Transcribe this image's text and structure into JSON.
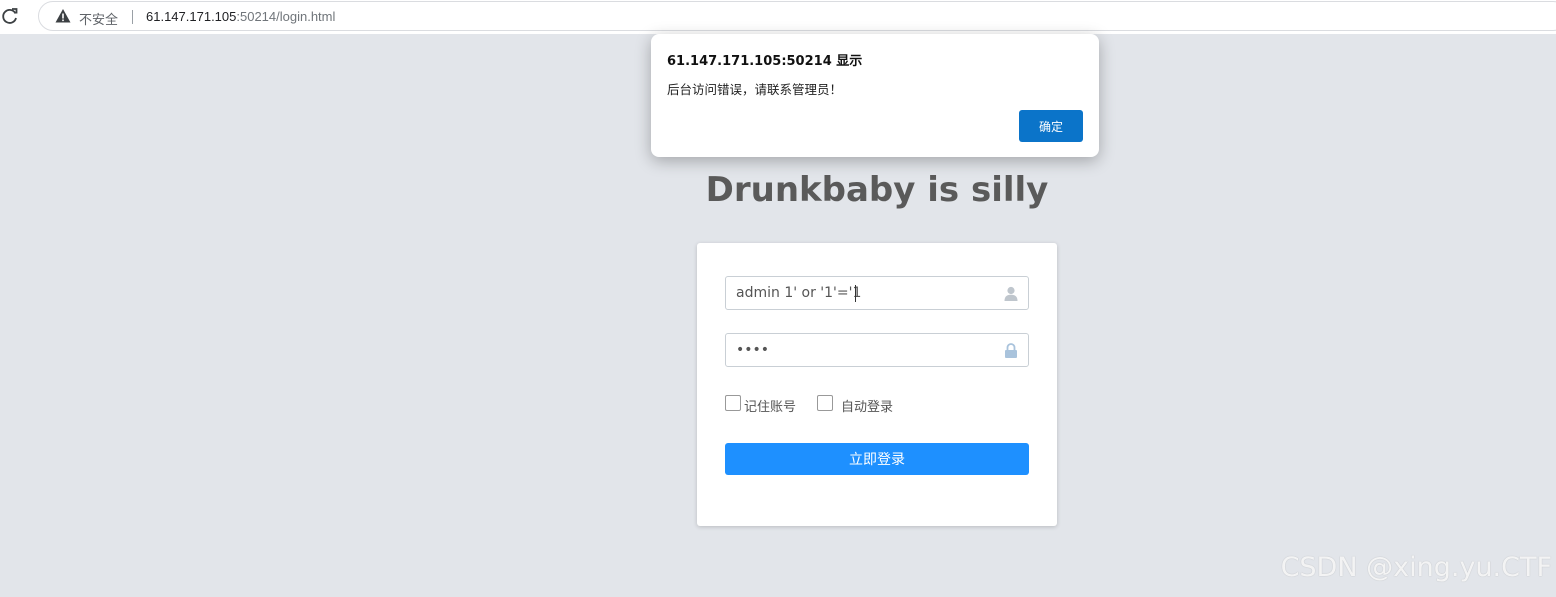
{
  "browser": {
    "security_label": "不安全",
    "url_host": "61.147.171.105",
    "url_rest": ":50214/login.html"
  },
  "page": {
    "title": "Drunkbaby is silly"
  },
  "login": {
    "username_value": "admin 1' or '1'='1",
    "password_value": "1234",
    "remember_label": "记住账号",
    "autologin_label": "自动登录",
    "submit_label": "立即登录",
    "accent_color": "#1e90ff"
  },
  "alert": {
    "title": "61.147.171.105:50214 显示",
    "message": "后台访问错误，请联系管理员！",
    "ok_label": "确定",
    "ok_color": "#0b74c9"
  },
  "watermark": {
    "text": "CSDN @xing.yu.CTF"
  }
}
